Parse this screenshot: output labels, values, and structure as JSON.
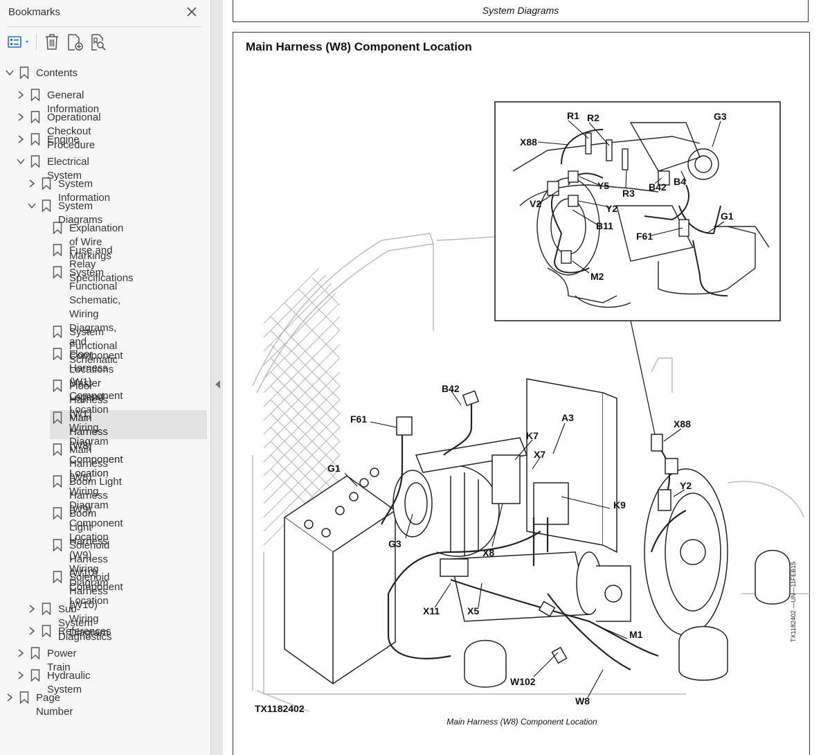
{
  "panel": {
    "title": "Bookmarks",
    "tree": [
      {
        "label": "Contents",
        "depth": 0,
        "state": "expanded"
      },
      {
        "label": "General Information",
        "depth": 1,
        "state": "collapsed"
      },
      {
        "label": "Operational Checkout Procedure",
        "depth": 1,
        "state": "collapsed"
      },
      {
        "label": "Engine",
        "depth": 1,
        "state": "collapsed"
      },
      {
        "label": "Electrical System",
        "depth": 1,
        "state": "expanded"
      },
      {
        "label": "System Information",
        "depth": 2,
        "state": "collapsed"
      },
      {
        "label": "System Diagrams",
        "depth": 2,
        "state": "expanded"
      },
      {
        "label": "Explanation of Wire Markings",
        "depth": 3,
        "state": "leaf"
      },
      {
        "label": "Fuse and Relay Specifications",
        "depth": 3,
        "state": "leaf"
      },
      {
        "label": "System Functional Schematic,\nWiring Diagrams, and\nComponent Locations Master\nLegend",
        "depth": 3,
        "state": "leaf"
      },
      {
        "label": "System Functional Schematic",
        "depth": 3,
        "state": "leaf"
      },
      {
        "label": "Floor Harness (W1)\nComponent Location",
        "depth": 3,
        "state": "leaf"
      },
      {
        "label": "Floor Harness (W1) Wiring\nDiagram",
        "depth": 3,
        "state": "leaf"
      },
      {
        "label": "Main Harness (W8)\nComponent Location",
        "depth": 3,
        "state": "leaf",
        "selected": true
      },
      {
        "label": "Main Harness (W8) Wiring\nDiagram",
        "depth": 3,
        "state": "leaf"
      },
      {
        "label": "Boom Light Harness (W9)\nComponent Location",
        "depth": 3,
        "state": "leaf"
      },
      {
        "label": "Boom Light Harness (W9)\nWiring Diagram",
        "depth": 3,
        "state": "leaf"
      },
      {
        "label": "Solenoid Harness (W10)\nComponent Location",
        "depth": 3,
        "state": "leaf"
      },
      {
        "label": "Solenoid Harness (W10)\nWiring Diagram",
        "depth": 3,
        "state": "leaf"
      },
      {
        "label": "Sub-System Diagnostics",
        "depth": 2,
        "state": "collapsed"
      },
      {
        "label": "References",
        "depth": 2,
        "state": "collapsed"
      },
      {
        "label": "Power Train",
        "depth": 1,
        "state": "collapsed"
      },
      {
        "label": "Hydraulic System",
        "depth": 1,
        "state": "collapsed"
      },
      {
        "label": "Page Number",
        "depth": 0,
        "state": "collapsed"
      }
    ]
  },
  "document": {
    "header": "System Diagrams",
    "section_title": "Main Harness (W8) Component Location",
    "figure_id": "TX1182402",
    "figure_caption": "Main Harness (W8) Component Location",
    "side_code": "TX1182402 —UN—11FEB15",
    "inset_callouts": {
      "R1": "R1",
      "R2": "R2",
      "G3": "G3",
      "X88": "X88",
      "Y5": "Y5",
      "R3": "R3",
      "B42": "B42",
      "B4": "B4",
      "V2": "V2",
      "Y2": "Y2",
      "B11": "B11",
      "G1": "G1",
      "F61": "F61",
      "M2": "M2"
    },
    "main_callouts": {
      "B42": "B42",
      "F61": "F61",
      "A3": "A3",
      "K7": "K7",
      "X88": "X88",
      "X7": "X7",
      "G1": "G1",
      "Y2": "Y2",
      "K9": "K9",
      "G3": "G3",
      "X8": "X8",
      "X11": "X11",
      "X5": "X5",
      "M1": "M1",
      "W102": "W102",
      "W8": "W8"
    }
  },
  "colors": {
    "selected_bg": "#e3e3e3",
    "toolbar_icon": "#1f6fc5",
    "text": "#333333"
  }
}
